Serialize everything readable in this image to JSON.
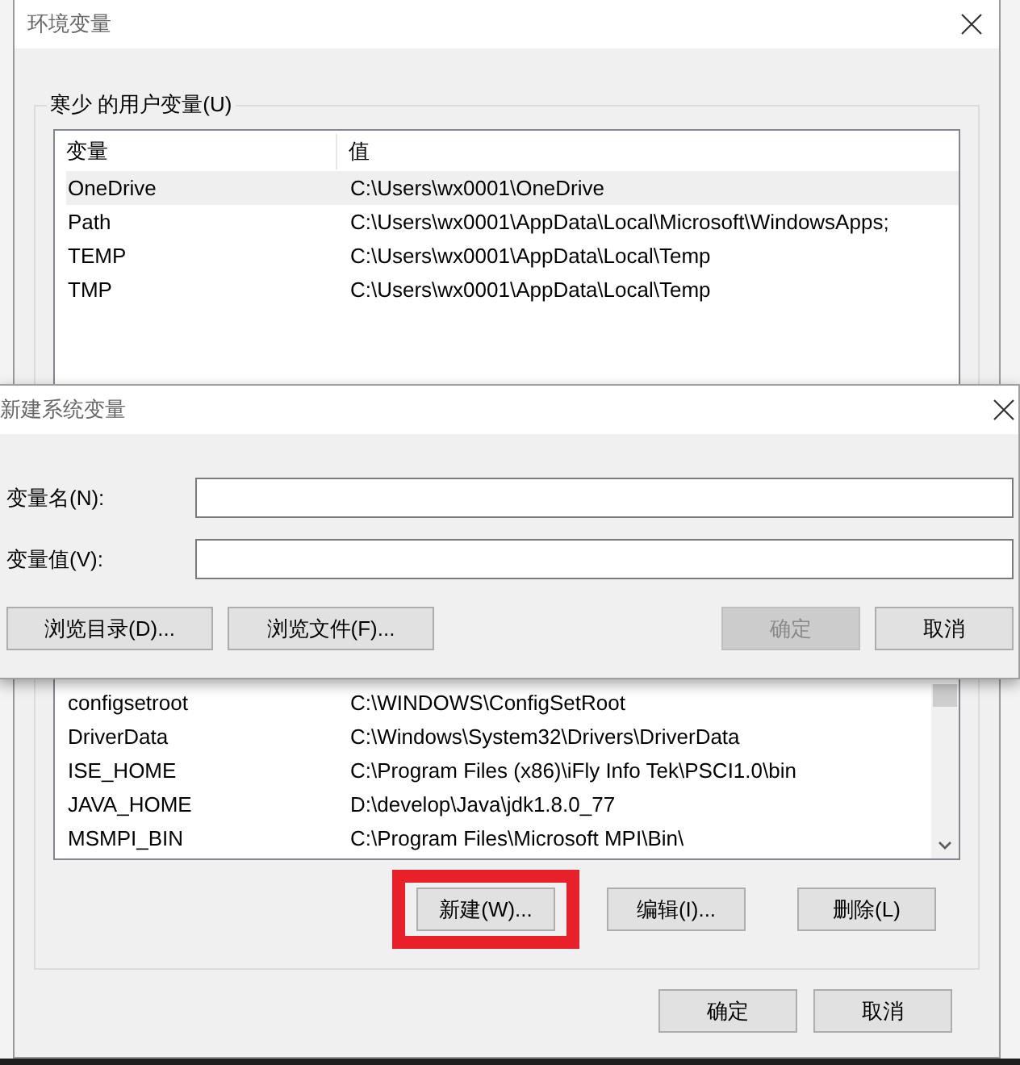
{
  "main_window": {
    "title": "环境变量",
    "user_variables": {
      "title": "寒少 的用户变量(U)",
      "columns": [
        "变量",
        "值"
      ],
      "rows": [
        {
          "name": "OneDrive",
          "value": "C:\\Users\\wx0001\\OneDrive",
          "selected": true
        },
        {
          "name": "Path",
          "value": "C:\\Users\\wx0001\\AppData\\Local\\Microsoft\\WindowsApps;",
          "selected": false
        },
        {
          "name": "TEMP",
          "value": "C:\\Users\\wx0001\\AppData\\Local\\Temp",
          "selected": false
        },
        {
          "name": "TMP",
          "value": "C:\\Users\\wx0001\\AppData\\Local\\Temp",
          "selected": false
        }
      ]
    },
    "system_variables": {
      "rows": [
        {
          "name": "configsetroot",
          "value": "C:\\WINDOWS\\ConfigSetRoot",
          "selected": false
        },
        {
          "name": "DriverData",
          "value": "C:\\Windows\\System32\\Drivers\\DriverData",
          "selected": false
        },
        {
          "name": "ISE_HOME",
          "value": "C:\\Program Files (x86)\\iFly Info Tek\\PSCI1.0\\bin",
          "selected": false
        },
        {
          "name": "JAVA_HOME",
          "value": "D:\\develop\\Java\\jdk1.8.0_77",
          "selected": false
        },
        {
          "name": "MSMPI_BIN",
          "value": "C:\\Program Files\\Microsoft MPI\\Bin\\",
          "selected": false
        }
      ],
      "buttons": [
        {
          "label": "新建(W)...",
          "highlighted": true
        },
        {
          "label": "编辑(I)...",
          "highlighted": false
        },
        {
          "label": "删除(L)",
          "highlighted": false
        }
      ]
    },
    "buttons": [
      "确定",
      "取消"
    ]
  },
  "dialog": {
    "title": "新建系统变量",
    "fields": [
      {
        "label": "变量名(N):"
      },
      {
        "label": "变量值(V):"
      }
    ],
    "buttons": [
      {
        "label": "浏览目录(D)...",
        "disabled": false,
        "kind": "left"
      },
      {
        "label": "浏览文件(F)...",
        "disabled": false,
        "kind": "left"
      },
      {
        "label": "确定",
        "disabled": true,
        "kind": "right"
      },
      {
        "label": "取消",
        "disabled": false,
        "kind": "right"
      }
    ]
  }
}
